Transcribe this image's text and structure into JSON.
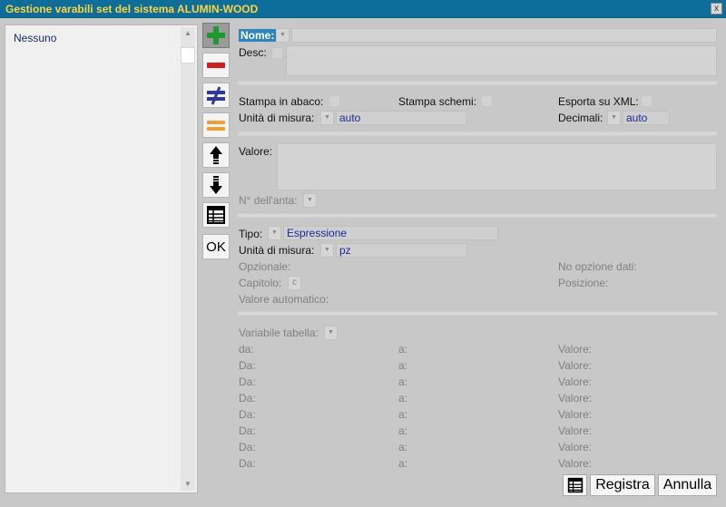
{
  "window": {
    "title": "Gestione varabili set  del sistema ALUMIN-WOOD",
    "close": "x"
  },
  "list": {
    "items": [
      "Nessuno"
    ]
  },
  "toolbar": {
    "ok_label": "OK"
  },
  "form": {
    "nome_label": "Nome:",
    "desc_label": "Desc:",
    "stampa_abaco_label": "Stampa in abaco:",
    "stampa_schemi_label": "Stampa schemi:",
    "esporta_xml_label": "Esporta su XML:",
    "unita_misura_label": "Unità di misura:",
    "unita_misura_value": "auto",
    "decimali_label": "Decimali:",
    "decimali_value": "auto",
    "valore_label": "Valore:",
    "n_anta_label": "N° dell'anta:",
    "tipo_label": "Tipo:",
    "tipo_value": "Espressione",
    "unita_misura2_label": "Unità di misura:",
    "unita_misura2_value": "pz",
    "opzionale_label": "Opzionale:",
    "no_opzione_label": "No opzione dati:",
    "capitolo_label": "Capitolo:",
    "capitolo_value": "c",
    "posizione_label": "Posizione:",
    "valore_automatico_label": "Valore automatico:",
    "variabile_tabella_label": "Variabile tabella:"
  },
  "table_rows": [
    {
      "from": "da:",
      "to": "a:",
      "value": "Valore:"
    },
    {
      "from": "Da:",
      "to": "a:",
      "value": "Valore:"
    },
    {
      "from": "Da:",
      "to": "a:",
      "value": "Valore:"
    },
    {
      "from": "Da:",
      "to": "a:",
      "value": "Valore:"
    },
    {
      "from": "Da:",
      "to": "a:",
      "value": "Valore:"
    },
    {
      "from": "Da:",
      "to": "a:",
      "value": "Valore:"
    },
    {
      "from": "Da:",
      "to": "a:",
      "value": "Valore:"
    },
    {
      "from": "Da:",
      "to": "a:",
      "value": "Valore:"
    }
  ],
  "footer": {
    "registra_label": "Registra",
    "annulla_label": "Annulla"
  },
  "colors": {
    "title_bar": "#0d6e9a",
    "title_text": "#ffd43a",
    "plus": "#1f9a2e",
    "minus": "#d01c1c",
    "not_equal": "#2b3a9c",
    "equal": "#f0a030",
    "value_text": "#1a2a9c"
  }
}
